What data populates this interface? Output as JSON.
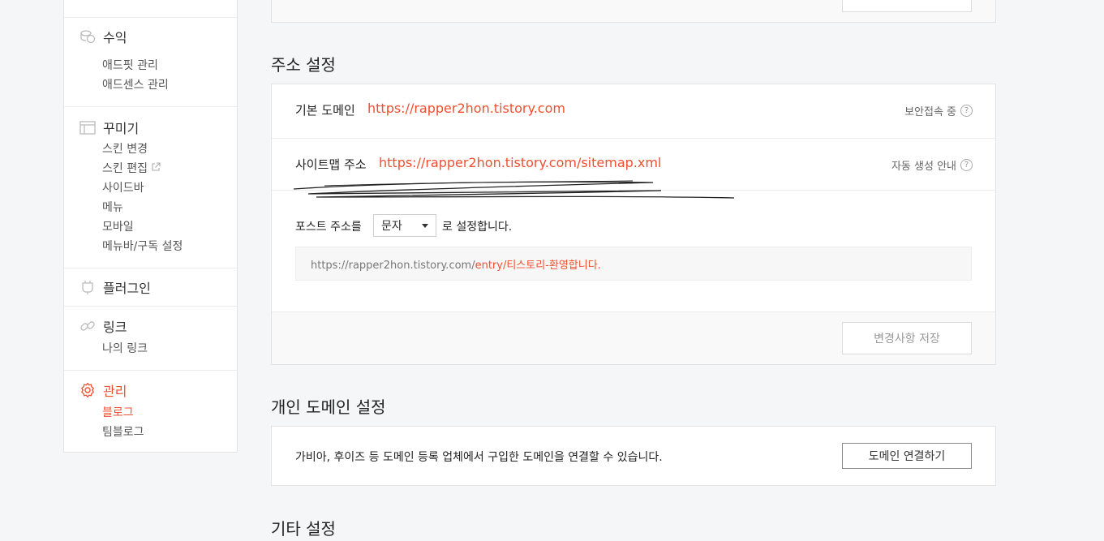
{
  "sidebar": {
    "revenue": {
      "title": "수익",
      "items": [
        "애드핏 관리",
        "애드센스 관리"
      ]
    },
    "decorate": {
      "title": "꾸미기",
      "items": [
        "스킨 변경",
        "스킨 편집",
        "사이드바",
        "메뉴",
        "모바일",
        "메뉴바/구독 설정"
      ]
    },
    "plugin": {
      "title": "플러그인"
    },
    "link": {
      "title": "링크",
      "items": [
        "나의 링크"
      ]
    },
    "manage": {
      "title": "관리",
      "items": [
        "블로그",
        "팀블로그"
      ]
    }
  },
  "address": {
    "title": "주소 설정",
    "default_domain_label": "기본 도메인",
    "default_domain_url": "https://rapper2hon.tistory.com",
    "secure_label": "보안접속 중",
    "sitemap_label": "사이트맵 주소",
    "sitemap_url": "https://rapper2hon.tistory.com/sitemap.xml",
    "sitemap_help": "자동 생성 안내",
    "post_prefix": "포스트 주소를",
    "post_select_value": "문자",
    "post_suffix": "로 설정합니다.",
    "preview_base": "https://rapper2hon.tistory.com/",
    "preview_path": "entry/티스토리-환영합니다.",
    "save_button": "변경사항 저장"
  },
  "custom_domain": {
    "title": "개인 도메인 설정",
    "description": "가비아, 후이즈 등 도메인 등록 업체에서 구입한 도메인을 연결할 수 있습니다.",
    "connect_button": "도메인 연결하기"
  },
  "other": {
    "title": "기타 설정"
  },
  "colors": {
    "accent": "#f04f2f",
    "background": "#f5f6f7"
  }
}
